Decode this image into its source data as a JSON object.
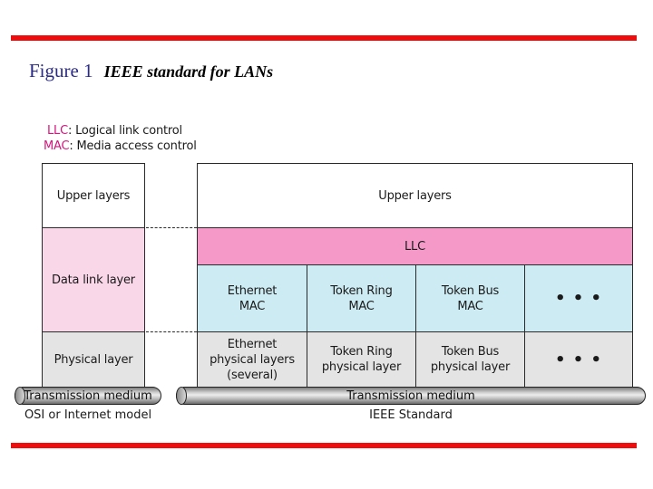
{
  "figure": {
    "number": "Figure 1",
    "caption": "IEEE standard for LANs",
    "accent_color": "#ee0c0c",
    "number_color": "#2b2b86"
  },
  "legend": [
    {
      "abbr": "LLC",
      "text": ": Logical link control"
    },
    {
      "abbr": "MAC",
      "text": ": Media access control"
    }
  ],
  "osi_model": {
    "caption": "OSI or Internet model",
    "layers": [
      {
        "label": "Upper layers",
        "color": "#ffffff"
      },
      {
        "label": "Data link layer",
        "color": "#fad7e8"
      },
      {
        "label": "Physical layer",
        "color": "#e4e4e4"
      }
    ],
    "medium": "Transmission medium"
  },
  "ieee_standard": {
    "caption": "IEEE Standard",
    "upper": "Upper layers",
    "llc": "LLC",
    "mac_row": [
      {
        "line1": "Ethernet",
        "line2": "MAC"
      },
      {
        "line1": "Token Ring",
        "line2": "MAC"
      },
      {
        "line1": "Token Bus",
        "line2": "MAC"
      },
      {
        "line1": "• • •",
        "line2": ""
      }
    ],
    "physical_row": [
      {
        "line1": "Ethernet",
        "line2": "physical layers",
        "line3": "(several)"
      },
      {
        "line1": "Token Ring",
        "line2": "physical layer",
        "line3": ""
      },
      {
        "line1": "Token Bus",
        "line2": "physical layer",
        "line3": ""
      },
      {
        "line1": "• • •",
        "line2": "",
        "line3": ""
      }
    ],
    "medium": "Transmission medium",
    "colors": {
      "llc": "#f599c9",
      "mac": "#cdebf3",
      "physical": "#e4e4e4"
    }
  }
}
